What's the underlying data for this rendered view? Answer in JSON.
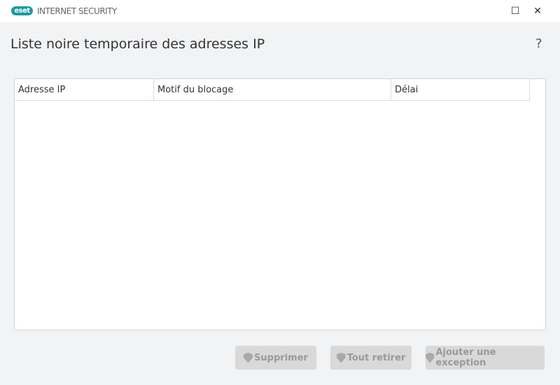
{
  "app": {
    "logo": "eset",
    "name": "INTERNET SECURITY"
  },
  "window": {
    "minimize": "☐",
    "close": "✕"
  },
  "page": {
    "title": "Liste noire temporaire des adresses IP",
    "help": "?"
  },
  "table": {
    "columns": [
      "Adresse IP",
      "Motif du blocage",
      "Délai"
    ],
    "rows": []
  },
  "buttons": {
    "delete": "Supprimer",
    "remove_all": "Tout retirer",
    "add_exception": "Ajouter une exception"
  }
}
